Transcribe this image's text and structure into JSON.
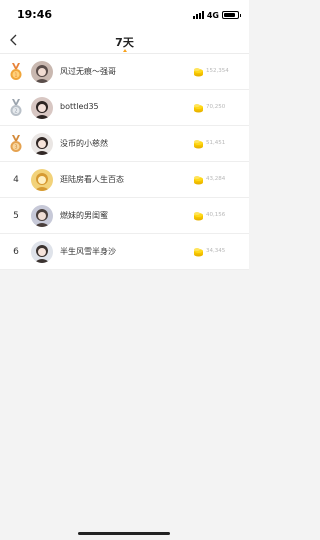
{
  "status_bar": {
    "time": "19:46",
    "network": "4G",
    "battery_level": 0.85
  },
  "nav": {
    "back_icon": "chevron-left-icon",
    "title": "7天",
    "accent_color": "#f7a21d"
  },
  "ranking": {
    "coin_icon": "gold-coin-icon",
    "items": [
      {
        "rank": "1",
        "badge": "gold-medal-icon",
        "name": "风过无痕～强哥",
        "score": "152,354"
      },
      {
        "rank": "2",
        "badge": "silver-medal-icon",
        "name": "bottled35",
        "score": "70,250"
      },
      {
        "rank": "3",
        "badge": "bronze-medal-icon",
        "name": "没币的小慈然",
        "score": "51,451"
      },
      {
        "rank": "4",
        "badge": "",
        "name": "逛陆房看人生百态",
        "score": "43,284"
      },
      {
        "rank": "5",
        "badge": "",
        "name": "燃妹的男闺蜜",
        "score": "40,156"
      },
      {
        "rank": "6",
        "badge": "",
        "name": "半生风雪半身沙",
        "score": "34,345"
      }
    ]
  }
}
